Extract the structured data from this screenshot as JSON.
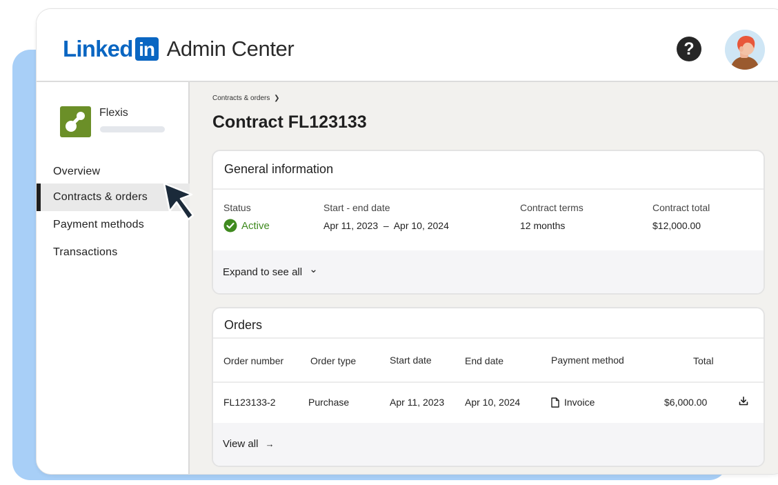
{
  "header": {
    "logo_linked": "Linked",
    "logo_in": "in",
    "logo_admin": "Admin Center",
    "help_icon": "question-mark-icon",
    "help_label": "?",
    "avatar_icon": "user-avatar"
  },
  "sidebar": {
    "org_name": "Flexis",
    "items": [
      {
        "label": "Overview",
        "active": false
      },
      {
        "label": "Contracts & orders",
        "active": true
      },
      {
        "label": "Payment methods",
        "active": false
      },
      {
        "label": "Transactions",
        "active": false
      }
    ]
  },
  "main": {
    "breadcrumb": "Contracts & orders",
    "breadcrumb_chevron": "❯",
    "title": "Contract FL123133",
    "general": {
      "title": "General information",
      "fields": [
        {
          "label": "Status",
          "value": "Active"
        },
        {
          "label": "Start - end date",
          "value": "Apr 11, 2023  –  Apr 10, 2024"
        },
        {
          "label": "Contract terms",
          "value": "12 months"
        },
        {
          "label": "Contract total",
          "value": "$12,000.00"
        }
      ],
      "expand_label": "Expand to see all",
      "expand_icon": "⌄"
    },
    "orders": {
      "title": "Orders",
      "columns": [
        "Order number",
        "Order type",
        "Start date",
        "End date",
        "Payment method",
        "Total"
      ],
      "rows": [
        {
          "order_number": "FL123133-2",
          "order_type": "Purchase",
          "start_date": "Apr 11, 2023",
          "end_date": "Apr 10, 2024",
          "payment_method": "Invoice",
          "total": "$6,000.00"
        }
      ],
      "view_all_label": "View all",
      "view_all_arrow": "→"
    }
  },
  "colors": {
    "brand": "#0a66c2",
    "status_active": "#3f8a1f",
    "backdrop": "#a8cff7",
    "org_icon": "#6b8f28"
  }
}
